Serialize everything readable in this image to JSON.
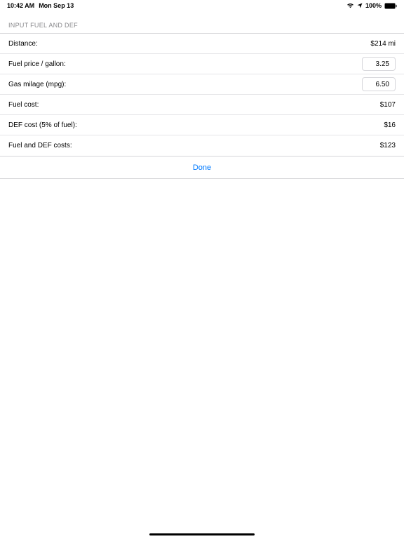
{
  "status": {
    "time": "10:42 AM",
    "date": "Mon Sep 13",
    "battery": "100%"
  },
  "section_header": "INPUT FUEL AND DEF",
  "rows": {
    "distance": {
      "label": "Distance:",
      "value": "$214 mi"
    },
    "fuel_price": {
      "label": "Fuel price / gallon:",
      "value": "3.25"
    },
    "gas_mileage": {
      "label": "Gas milage (mpg):",
      "value": "6.50"
    },
    "fuel_cost": {
      "label": "Fuel cost:",
      "value": "$107"
    },
    "def_cost": {
      "label": "DEF cost (5% of fuel):",
      "value": "$16"
    },
    "fuel_def_costs": {
      "label": "Fuel and DEF costs:",
      "value": "$123"
    }
  },
  "done_label": "Done"
}
